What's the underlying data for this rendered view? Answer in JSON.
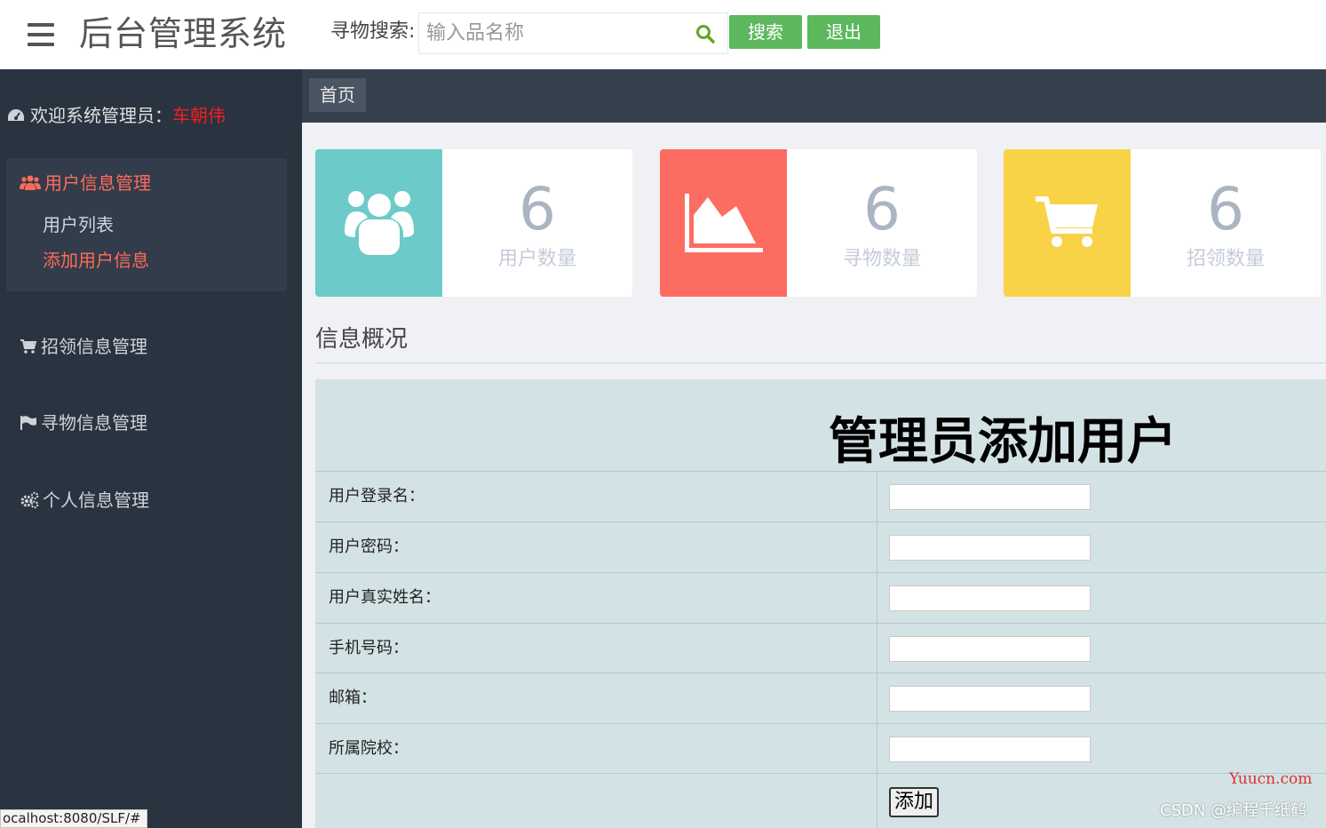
{
  "header": {
    "title": "后台管理系统",
    "search_label": "寻物搜索:",
    "search_placeholder": "输入品名称",
    "search_button": "搜索",
    "logout_button": "退出"
  },
  "sidebar": {
    "welcome_prefix": "欢迎系统管理员：",
    "welcome_user": "车朝伟",
    "groups": [
      {
        "label": "用户信息管理",
        "icon": "users-icon",
        "active": true,
        "items": [
          {
            "label": "用户列表"
          },
          {
            "label": "添加用户信息",
            "active": true
          }
        ]
      },
      {
        "label": "招领信息管理",
        "icon": "cart-icon"
      },
      {
        "label": "寻物信息管理",
        "icon": "flag-icon"
      },
      {
        "label": "个人信息管理",
        "icon": "gears-icon"
      }
    ]
  },
  "breadcrumb": {
    "home": "首页"
  },
  "stats": [
    {
      "value": "6",
      "label": "用户数量",
      "icon": "users-icon",
      "color": "#6ccac9"
    },
    {
      "value": "6",
      "label": "寻物数量",
      "icon": "area-chart-icon",
      "color": "#fd6c60"
    },
    {
      "value": "6",
      "label": "招领数量",
      "icon": "shopping-cart-icon",
      "color": "#f8d347"
    }
  ],
  "section_title": "信息概况",
  "form": {
    "heading": "管理员添加用户",
    "fields": [
      {
        "label": "用户登录名：",
        "value": ""
      },
      {
        "label": "用户密码：",
        "value": ""
      },
      {
        "label": "用户真实姓名：",
        "value": ""
      },
      {
        "label": "手机号码：",
        "value": ""
      },
      {
        "label": "邮箱：",
        "value": ""
      },
      {
        "label": "所属院校：",
        "value": ""
      }
    ],
    "submit": "添加"
  },
  "status_url": "ocalhost:8080/SLF/#",
  "watermarks": {
    "site": "Yuucn.com",
    "csdn": "CSDN @编程千纸鹤"
  }
}
